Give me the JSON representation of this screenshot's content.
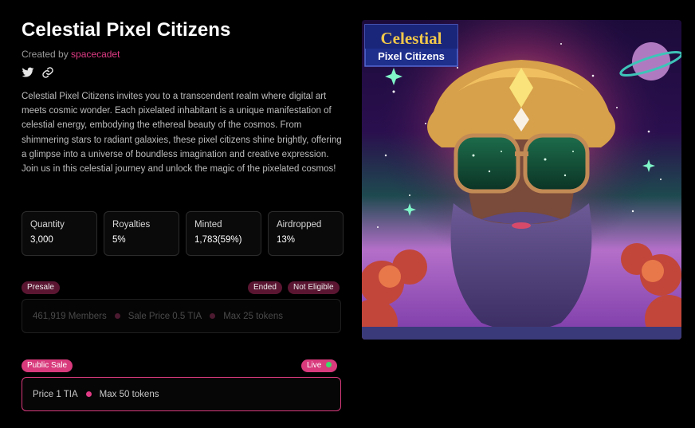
{
  "collection": {
    "title": "Celestial Pixel Citizens",
    "created_by_label": "Created by",
    "creator": "spacecadet",
    "description": "Celestial Pixel Citizens invites you to a transcendent realm where digital art meets cosmic wonder. Each pixelated inhabitant is a unique manifestation of celestial energy, embodying the ethereal beauty of the cosmos. From shimmering stars to radiant galaxies, these pixel citizens shine brightly, offering a glimpse into a universe of boundless imagination and creative expression. Join us in this celestial journey and unlock the magic of the pixelated cosmos!"
  },
  "socials": {
    "icons": [
      "twitter-icon",
      "link-icon"
    ]
  },
  "stats": [
    {
      "label": "Quantity",
      "value": "3,000"
    },
    {
      "label": "Royalties",
      "value": "5%"
    },
    {
      "label": "Minted",
      "value": "1,783(59%)"
    },
    {
      "label": "Airdropped",
      "value": "13%"
    }
  ],
  "presale": {
    "badge": "Presale",
    "status": "Ended",
    "eligibility": "Not Eligible",
    "members": "461,919 Members",
    "price": "Sale Price 0.5 TIA",
    "max": "Max 25 tokens"
  },
  "public_sale": {
    "badge": "Public Sale",
    "status": "Live",
    "price": "Price 1 TIA",
    "max": "Max 50 tokens"
  },
  "artwork": {
    "caption_line1": "Celestial",
    "caption_line2": "Pixel Citizens"
  },
  "colors": {
    "accent": "#e23b86",
    "badge_dark": "#5a1631",
    "live_dot": "#3ddc6a",
    "background": "#000000"
  }
}
